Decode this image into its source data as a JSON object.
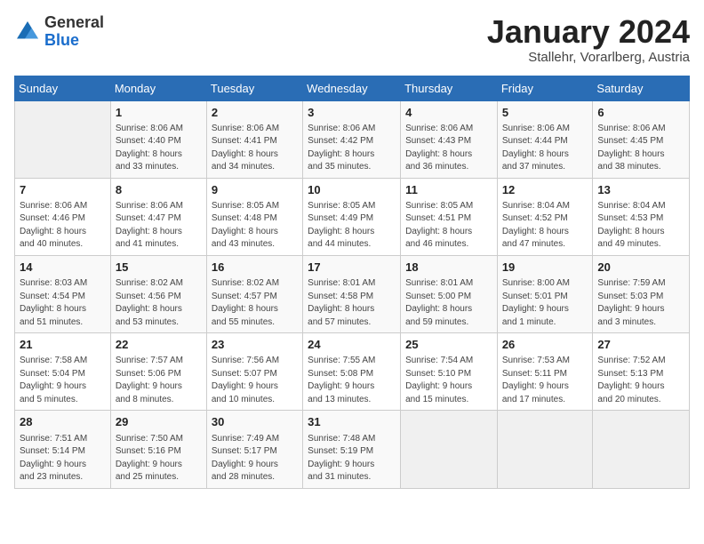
{
  "header": {
    "logo_general": "General",
    "logo_blue": "Blue",
    "month": "January 2024",
    "location": "Stallehr, Vorarlberg, Austria"
  },
  "columns": [
    "Sunday",
    "Monday",
    "Tuesday",
    "Wednesday",
    "Thursday",
    "Friday",
    "Saturday"
  ],
  "weeks": [
    [
      {
        "day": "",
        "info": ""
      },
      {
        "day": "1",
        "info": "Sunrise: 8:06 AM\nSunset: 4:40 PM\nDaylight: 8 hours\nand 33 minutes."
      },
      {
        "day": "2",
        "info": "Sunrise: 8:06 AM\nSunset: 4:41 PM\nDaylight: 8 hours\nand 34 minutes."
      },
      {
        "day": "3",
        "info": "Sunrise: 8:06 AM\nSunset: 4:42 PM\nDaylight: 8 hours\nand 35 minutes."
      },
      {
        "day": "4",
        "info": "Sunrise: 8:06 AM\nSunset: 4:43 PM\nDaylight: 8 hours\nand 36 minutes."
      },
      {
        "day": "5",
        "info": "Sunrise: 8:06 AM\nSunset: 4:44 PM\nDaylight: 8 hours\nand 37 minutes."
      },
      {
        "day": "6",
        "info": "Sunrise: 8:06 AM\nSunset: 4:45 PM\nDaylight: 8 hours\nand 38 minutes."
      }
    ],
    [
      {
        "day": "7",
        "info": "Sunrise: 8:06 AM\nSunset: 4:46 PM\nDaylight: 8 hours\nand 40 minutes."
      },
      {
        "day": "8",
        "info": "Sunrise: 8:06 AM\nSunset: 4:47 PM\nDaylight: 8 hours\nand 41 minutes."
      },
      {
        "day": "9",
        "info": "Sunrise: 8:05 AM\nSunset: 4:48 PM\nDaylight: 8 hours\nand 43 minutes."
      },
      {
        "day": "10",
        "info": "Sunrise: 8:05 AM\nSunset: 4:49 PM\nDaylight: 8 hours\nand 44 minutes."
      },
      {
        "day": "11",
        "info": "Sunrise: 8:05 AM\nSunset: 4:51 PM\nDaylight: 8 hours\nand 46 minutes."
      },
      {
        "day": "12",
        "info": "Sunrise: 8:04 AM\nSunset: 4:52 PM\nDaylight: 8 hours\nand 47 minutes."
      },
      {
        "day": "13",
        "info": "Sunrise: 8:04 AM\nSunset: 4:53 PM\nDaylight: 8 hours\nand 49 minutes."
      }
    ],
    [
      {
        "day": "14",
        "info": "Sunrise: 8:03 AM\nSunset: 4:54 PM\nDaylight: 8 hours\nand 51 minutes."
      },
      {
        "day": "15",
        "info": "Sunrise: 8:02 AM\nSunset: 4:56 PM\nDaylight: 8 hours\nand 53 minutes."
      },
      {
        "day": "16",
        "info": "Sunrise: 8:02 AM\nSunset: 4:57 PM\nDaylight: 8 hours\nand 55 minutes."
      },
      {
        "day": "17",
        "info": "Sunrise: 8:01 AM\nSunset: 4:58 PM\nDaylight: 8 hours\nand 57 minutes."
      },
      {
        "day": "18",
        "info": "Sunrise: 8:01 AM\nSunset: 5:00 PM\nDaylight: 8 hours\nand 59 minutes."
      },
      {
        "day": "19",
        "info": "Sunrise: 8:00 AM\nSunset: 5:01 PM\nDaylight: 9 hours\nand 1 minute."
      },
      {
        "day": "20",
        "info": "Sunrise: 7:59 AM\nSunset: 5:03 PM\nDaylight: 9 hours\nand 3 minutes."
      }
    ],
    [
      {
        "day": "21",
        "info": "Sunrise: 7:58 AM\nSunset: 5:04 PM\nDaylight: 9 hours\nand 5 minutes."
      },
      {
        "day": "22",
        "info": "Sunrise: 7:57 AM\nSunset: 5:06 PM\nDaylight: 9 hours\nand 8 minutes."
      },
      {
        "day": "23",
        "info": "Sunrise: 7:56 AM\nSunset: 5:07 PM\nDaylight: 9 hours\nand 10 minutes."
      },
      {
        "day": "24",
        "info": "Sunrise: 7:55 AM\nSunset: 5:08 PM\nDaylight: 9 hours\nand 13 minutes."
      },
      {
        "day": "25",
        "info": "Sunrise: 7:54 AM\nSunset: 5:10 PM\nDaylight: 9 hours\nand 15 minutes."
      },
      {
        "day": "26",
        "info": "Sunrise: 7:53 AM\nSunset: 5:11 PM\nDaylight: 9 hours\nand 17 minutes."
      },
      {
        "day": "27",
        "info": "Sunrise: 7:52 AM\nSunset: 5:13 PM\nDaylight: 9 hours\nand 20 minutes."
      }
    ],
    [
      {
        "day": "28",
        "info": "Sunrise: 7:51 AM\nSunset: 5:14 PM\nDaylight: 9 hours\nand 23 minutes."
      },
      {
        "day": "29",
        "info": "Sunrise: 7:50 AM\nSunset: 5:16 PM\nDaylight: 9 hours\nand 25 minutes."
      },
      {
        "day": "30",
        "info": "Sunrise: 7:49 AM\nSunset: 5:17 PM\nDaylight: 9 hours\nand 28 minutes."
      },
      {
        "day": "31",
        "info": "Sunrise: 7:48 AM\nSunset: 5:19 PM\nDaylight: 9 hours\nand 31 minutes."
      },
      {
        "day": "",
        "info": ""
      },
      {
        "day": "",
        "info": ""
      },
      {
        "day": "",
        "info": ""
      }
    ]
  ]
}
